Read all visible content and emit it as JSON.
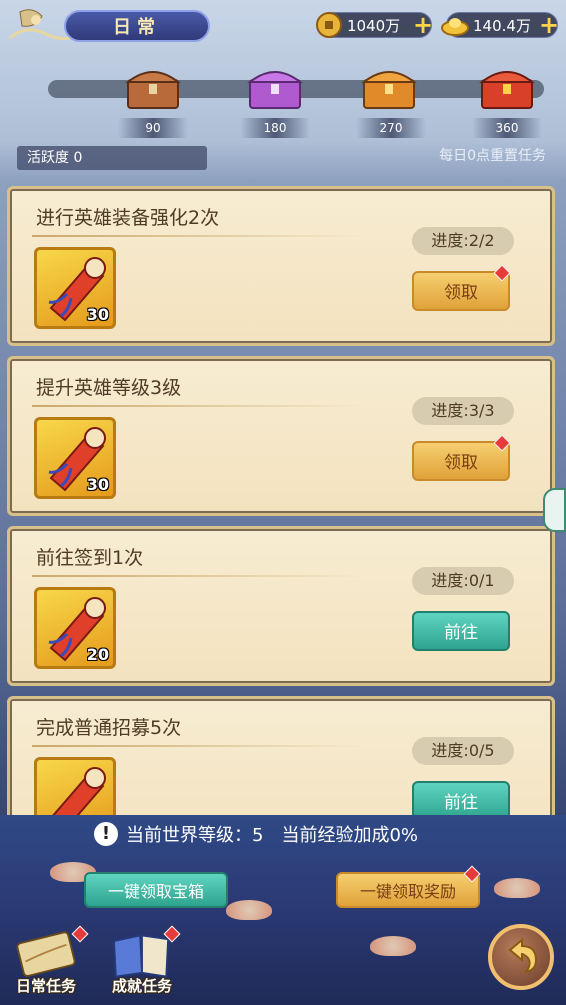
{
  "header": {
    "title": "日常",
    "currency": [
      {
        "name": "copper-coin-icon",
        "value": "1040万"
      },
      {
        "name": "gold-ingot-icon",
        "value": "140.4万"
      }
    ]
  },
  "activity": {
    "milestones": [
      "90",
      "180",
      "270",
      "360"
    ],
    "chest_colors": [
      "#b86a3a",
      "#b05ad0",
      "#e08a2a",
      "#d8402a"
    ],
    "label": "活跃度 0",
    "reset_note": "每日0点重置任务"
  },
  "tasks": [
    {
      "title": "进行英雄装备强化2次",
      "progress": "进度:2/2",
      "reward_count": "30",
      "button": "领取",
      "state": "claim"
    },
    {
      "title": "提升英雄等级3级",
      "progress": "进度:3/3",
      "reward_count": "30",
      "button": "领取",
      "state": "claim"
    },
    {
      "title": "前往签到1次",
      "progress": "进度:0/1",
      "reward_count": "20",
      "button": "前往",
      "state": "go"
    },
    {
      "title": "完成普通招募5次",
      "progress": "进度:0/5",
      "reward_count": "",
      "button": "前往",
      "state": "go"
    }
  ],
  "footer": {
    "world_info": "当前世界等级：5　当前经验加成0%",
    "claim_chest": "一键领取宝箱",
    "claim_rewards": "一键领取奖励",
    "tabs": [
      "日常任务",
      "成就任务"
    ]
  },
  "colors": {
    "accent": "#f6cf70",
    "go": "#2ea48f",
    "badge": "#e53b3b"
  }
}
